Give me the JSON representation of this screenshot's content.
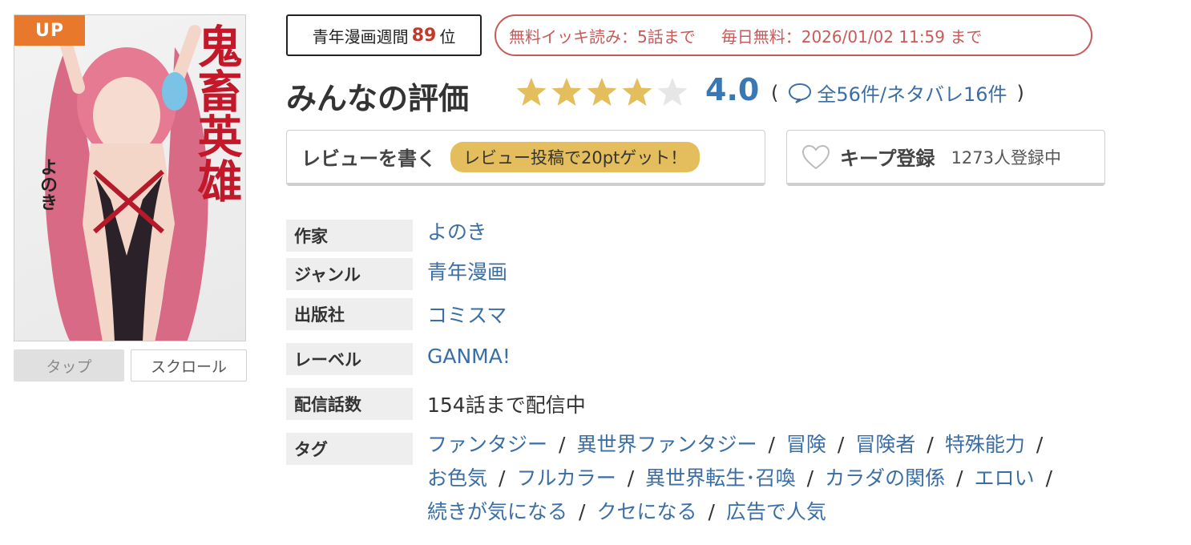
{
  "cover": {
    "badge": "UP",
    "title": "鬼畜英雄",
    "author": "よのき",
    "view_modes": [
      "タップ",
      "スクロール"
    ]
  },
  "ranking": {
    "label": "青年漫画週間",
    "rank": "89",
    "suffix": "位"
  },
  "free_info": {
    "ikki": "無料イッキ読み：5話まで",
    "daily": "毎日無料：2026/01/02 11:59 まで"
  },
  "rating": {
    "title": "みんなの評価",
    "value": "4.0",
    "stars": 4,
    "open_paren": "(",
    "count_text": "全56件/ネタバレ16件",
    "close_paren": ")"
  },
  "actions": {
    "review_label": "レビューを書く",
    "review_bonus": "レビュー投稿で20ptゲット！",
    "keep_label": "キープ登録",
    "keep_count": "1273人登録中"
  },
  "info": {
    "author_label": "作家",
    "author": "よのき",
    "genre_label": "ジャンル",
    "genre": "青年漫画",
    "publisher_label": "出版社",
    "publisher": "コミスマ",
    "label_label": "レーベル",
    "label": "GANMA!",
    "episodes_label": "配信話数",
    "episodes": "154話まで配信中",
    "tags_label": "タグ",
    "tags": [
      "ファンタジー",
      "異世界ファンタジー",
      "冒険",
      "冒険者",
      "特殊能力",
      "お色気",
      "フルカラー",
      "異世界転生･召喚",
      "カラダの関係",
      "エロい",
      "続きが気になる",
      "クセになる",
      "広告で人気"
    ],
    "separator": "/"
  },
  "colors": {
    "accent_blue": "#3a6ea5",
    "rank_red": "#c0392b",
    "free_red": "#c85a5a",
    "star_gold": "#e4be5c",
    "badge_orange": "#e8782b"
  }
}
